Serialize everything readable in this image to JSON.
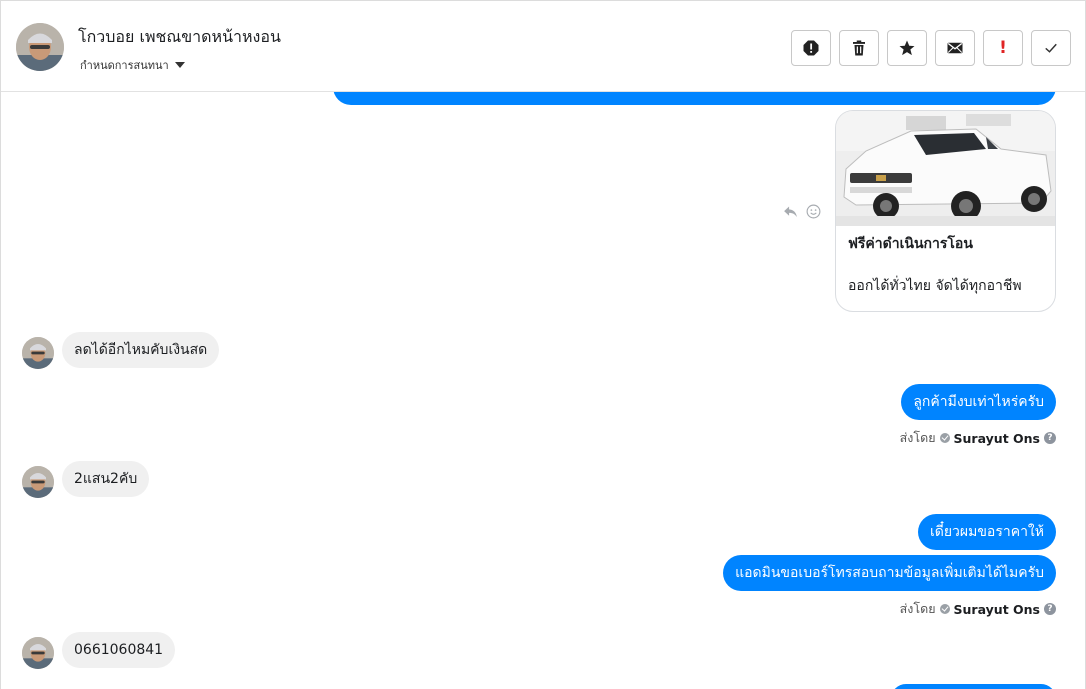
{
  "header": {
    "contact_name": "โกวบอย เพชณขาดหน้าหงอน",
    "assign_label": "กำหนดการสนทนา",
    "actions": [
      {
        "name": "report-spam-button",
        "icon": "alert-octagon-icon"
      },
      {
        "name": "delete-button",
        "icon": "trash-icon"
      },
      {
        "name": "star-button",
        "icon": "star-icon"
      },
      {
        "name": "mark-unread-button",
        "icon": "envelope-icon"
      },
      {
        "name": "mark-important-button",
        "icon": "exclamation-icon",
        "label": "!"
      },
      {
        "name": "mark-done-button",
        "icon": "check-icon"
      }
    ]
  },
  "card": {
    "title": "ฟรีค่าดำเนินการโอน",
    "subtitle": "ออกได้ทั่วไทย จัดได้ทุกอาชีพ"
  },
  "messages": [
    {
      "id": "m1",
      "direction": "in",
      "text": "ลดได้อีกไหมคับเงินสด"
    },
    {
      "id": "m2",
      "direction": "out",
      "text": "ลูกค้ามีงบเท่าไหร่ครับ"
    },
    {
      "id": "m3",
      "direction": "in",
      "text": "2แสน2คับ"
    },
    {
      "id": "m4",
      "direction": "out",
      "text": "เดี๋ยวผมขอราคาให้"
    },
    {
      "id": "m5",
      "direction": "out",
      "text": "แอดมินขอเบอร์โทรสอบถามข้อมูลเพิ่มเติมได้ไมครับ"
    },
    {
      "id": "m6",
      "direction": "in",
      "text": "0661060841"
    }
  ],
  "sent_by": {
    "prefix": "ส่งโดย",
    "agent": "Surayut Ons",
    "help": "?"
  },
  "colors": {
    "outgoing": "#0084ff",
    "incoming": "#f0f0f0",
    "important": "#e02424"
  }
}
